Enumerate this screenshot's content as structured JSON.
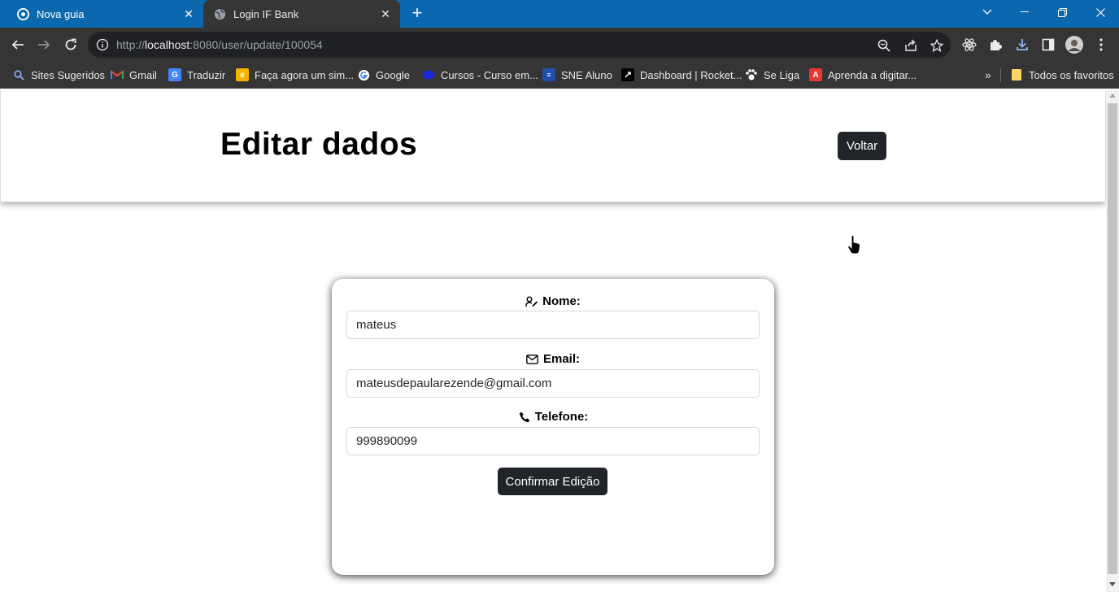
{
  "browser": {
    "tabs": [
      {
        "title": "Nova guia",
        "active": false
      },
      {
        "title": "Login IF Bank",
        "active": true
      }
    ],
    "url": {
      "scheme": "http://",
      "host": "localhost",
      "rest": ":8080/user/update/100054"
    },
    "bookmarks": [
      {
        "label": "Sites Sugeridos",
        "icon": "search-icon"
      },
      {
        "label": "Gmail",
        "icon": "gmail-icon"
      },
      {
        "label": "Traduzir",
        "icon": "translate-icon"
      },
      {
        "label": "Faça agora um sim...",
        "icon": "bookmark-favicon"
      },
      {
        "label": "Google",
        "icon": "google-icon"
      },
      {
        "label": "Cursos - Curso em...",
        "icon": "bookmark-favicon"
      },
      {
        "label": "SNE Aluno",
        "icon": "bookmark-favicon"
      },
      {
        "label": "Dashboard | Rocket...",
        "icon": "rocketseat-icon"
      },
      {
        "label": "Se Liga",
        "icon": "paw-icon"
      },
      {
        "label": "Aprenda a digitar...",
        "icon": "bookmark-favicon"
      }
    ],
    "all_bookmarks_label": "Todos os favoritos"
  },
  "page": {
    "title": "Editar dados",
    "back_button": "Voltar",
    "form": {
      "name_label": "Nome:",
      "name_value": "mateus",
      "email_label": "Email:",
      "email_value": "mateusdepaularezende@gmail.com",
      "phone_label": "Telefone:",
      "phone_value": "999890099",
      "submit_label": "Confirmar Edição"
    }
  },
  "colors": {
    "tabstrip": "#0b67ae",
    "toolbar": "#353535",
    "button_dark": "#212529"
  }
}
